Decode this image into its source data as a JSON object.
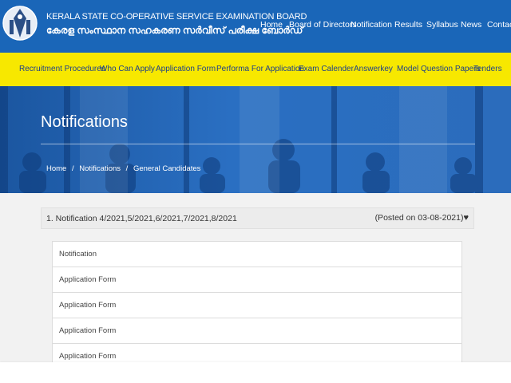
{
  "header": {
    "org_name_en": "KERALA STATE CO-OPERATIVE SERVICE EXAMINATION BOARD",
    "org_name_ml": "കേരള സംസ്ഥാന സഹകരണ സർവീസ് പരീക്ഷ ബോർഡ്",
    "nav": [
      "Home",
      "Board of Directors",
      "Notification",
      "Results",
      "Syllabus",
      "News",
      "Contact"
    ]
  },
  "subnav": [
    "Recruitment Procedures",
    "Who Can Apply",
    "Application Form",
    "Performa For Application",
    "Exam Calender",
    "Answerkey",
    "Model Question Papers",
    "Tenders"
  ],
  "hero": {
    "title": "Notifications",
    "breadcrumb": [
      "Home",
      "/",
      "Notifications",
      "/",
      "General Candidates"
    ]
  },
  "notification": {
    "title": "1. Notification 4/2021,5/2021,6/2021,7/2021,8/2021",
    "posted": "(Posted on 03-08-2021)",
    "toggle_icon": "heart-icon",
    "items": [
      "Notification",
      "Application Form",
      "Application Form",
      "Application Form",
      "Application Form"
    ]
  },
  "colors": {
    "header_blue": "#1a66b8",
    "nav_yellow": "#f7e800",
    "nav_text": "#1c3f8a"
  }
}
